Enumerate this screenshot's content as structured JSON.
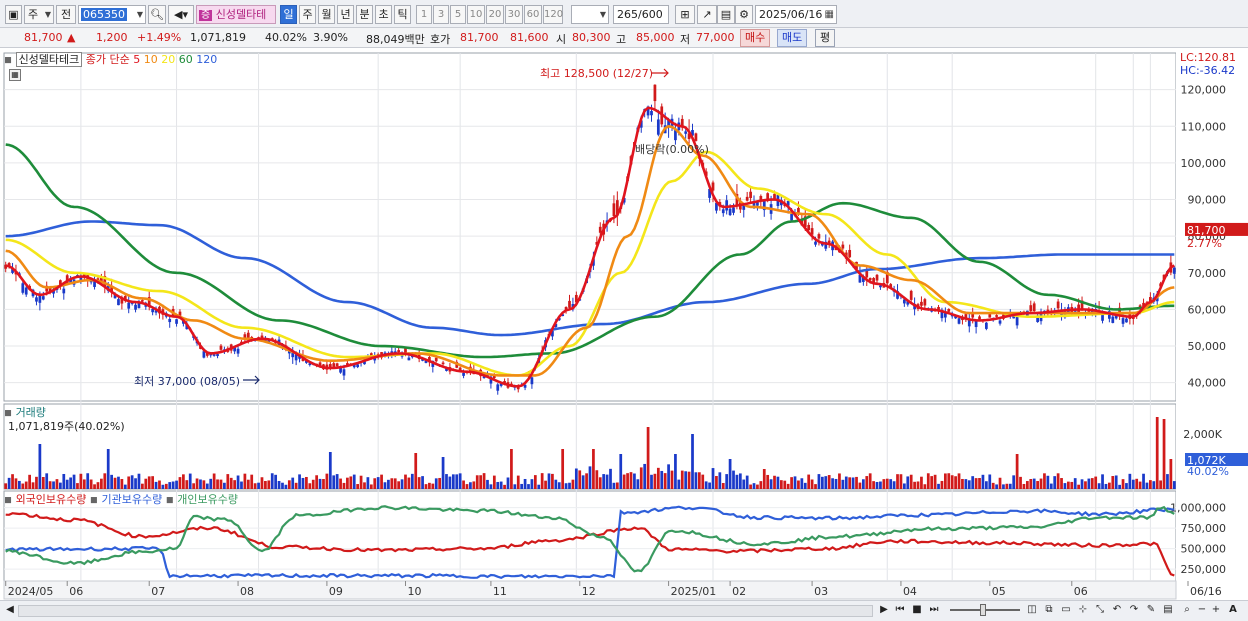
{
  "toolbar": {
    "market_label": "주",
    "prev_label": "전",
    "code": "065350",
    "stock_name": "신성델타테",
    "period_buttons": [
      "일",
      "주",
      "월",
      "년",
      "분",
      "초",
      "틱"
    ],
    "period_selected": "일",
    "num_buttons": [
      "1",
      "3",
      "5",
      "10",
      "20",
      "30",
      "60",
      "120"
    ],
    "count": "265",
    "count_total": "/600",
    "date": "2025/06/16"
  },
  "quote": {
    "price": "81,700",
    "change_arrow": "▲",
    "change": "1,200",
    "change_pct": "+1.49%",
    "volume": "1,071,819",
    "vol_ratio": "40.02%",
    "turnover": "3.90%",
    "amount": "88,049백만",
    "hoga_label": "호가",
    "ask": "81,700",
    "bid": "81,600",
    "open_label": "시",
    "open": "80,300",
    "high_label": "고",
    "high": "85,000",
    "low_label": "저",
    "low": "77,000",
    "buy_label": "매수",
    "sell_label": "매도",
    "eval_label": "평"
  },
  "price_panel": {
    "name": "신성델타테크",
    "ma_title": "종가 단순",
    "ma_periods": [
      "5",
      "10",
      "20",
      "60",
      "120"
    ],
    "lc": "LC:120.81",
    "hc": "HC:-36.42",
    "high_marker": "최고 128,500 (12/27)",
    "low_marker": "최저 37,000 (08/05)",
    "dividend_marker": "배당락(0.00%)",
    "y_ticks": [
      "120,000",
      "110,000",
      "100,000",
      "90,000",
      "80,000",
      "70,000",
      "60,000",
      "50,000",
      "40,000"
    ],
    "last_price": "81,700",
    "last_pct": "2.77%"
  },
  "volume_panel": {
    "title": "거래량",
    "value": "1,071,819주(40.02%)",
    "y_ticks": [
      "2,000K"
    ],
    "last_value": "1,072K",
    "last_pct": "40.02%"
  },
  "holdings_panel": {
    "series_labels": [
      "외국인보유수량",
      "기관보유수량",
      "개인보유수량"
    ],
    "y_ticks": [
      "1,000,000",
      "750,000",
      "500,000",
      "250,000"
    ]
  },
  "x_axis": {
    "labels": [
      "2024/05",
      "06",
      "07",
      "08",
      "09",
      "10",
      "11",
      "12",
      "2025/01",
      "02",
      "03",
      "04",
      "05",
      "06",
      "06/16"
    ]
  },
  "colors": {
    "up": "#d11a1a",
    "down": "#1a39c9",
    "ma5": "#e0141e",
    "ma10": "#f08a14",
    "ma20": "#f4e61a",
    "ma60": "#1e8c3a",
    "ma120": "#2f5fd9",
    "foreign": "#d11a1a",
    "institution": "#2f5fd9",
    "individual": "#3a9a60"
  },
  "chart_data": {
    "type": "candlestick",
    "y_range": [
      35000,
      130000
    ],
    "x_range": [
      "2024/05",
      "2025/06/16"
    ],
    "ma_anchors": {
      "ma5": [
        [
          0,
          72000
        ],
        [
          10,
          64000
        ],
        [
          22,
          69000
        ],
        [
          38,
          62000
        ],
        [
          50,
          58000
        ],
        [
          60,
          48000
        ],
        [
          75,
          52000
        ],
        [
          95,
          44000
        ],
        [
          115,
          48000
        ],
        [
          135,
          43000
        ],
        [
          150,
          39000
        ],
        [
          165,
          60000
        ],
        [
          178,
          85000
        ],
        [
          188,
          115000
        ],
        [
          198,
          110000
        ],
        [
          210,
          88000
        ],
        [
          225,
          90000
        ],
        [
          240,
          78000
        ],
        [
          255,
          67000
        ],
        [
          270,
          60000
        ],
        [
          285,
          57000
        ],
        [
          300,
          59000
        ],
        [
          315,
          60000
        ],
        [
          330,
          58000
        ],
        [
          335,
          62000
        ],
        [
          342,
          72000
        ]
      ],
      "ma10": [
        [
          0,
          76000
        ],
        [
          12,
          66000
        ],
        [
          25,
          68000
        ],
        [
          40,
          63000
        ],
        [
          55,
          57000
        ],
        [
          70,
          52000
        ],
        [
          95,
          46000
        ],
        [
          120,
          48000
        ],
        [
          145,
          42000
        ],
        [
          155,
          42000
        ],
        [
          170,
          55000
        ],
        [
          182,
          80000
        ],
        [
          194,
          110000
        ],
        [
          204,
          102000
        ],
        [
          218,
          88000
        ],
        [
          235,
          86000
        ],
        [
          250,
          72000
        ],
        [
          265,
          68000
        ],
        [
          282,
          59000
        ],
        [
          300,
          59000
        ],
        [
          330,
          59000
        ],
        [
          342,
          66000
        ]
      ],
      "ma20": [
        [
          0,
          79000
        ],
        [
          20,
          70000
        ],
        [
          45,
          65000
        ],
        [
          70,
          55000
        ],
        [
          100,
          47000
        ],
        [
          125,
          48000
        ],
        [
          150,
          42000
        ],
        [
          165,
          50000
        ],
        [
          180,
          70000
        ],
        [
          195,
          95000
        ],
        [
          205,
          103000
        ],
        [
          220,
          93000
        ],
        [
          240,
          86000
        ],
        [
          258,
          75000
        ],
        [
          275,
          62000
        ],
        [
          300,
          58000
        ],
        [
          330,
          59000
        ],
        [
          342,
          62000
        ]
      ],
      "ma60": [
        [
          0,
          105000
        ],
        [
          20,
          88000
        ],
        [
          50,
          70000
        ],
        [
          80,
          57000
        ],
        [
          110,
          50000
        ],
        [
          140,
          47000
        ],
        [
          160,
          48000
        ],
        [
          190,
          58000
        ],
        [
          215,
          75000
        ],
        [
          230,
          84000
        ],
        [
          245,
          89000
        ],
        [
          265,
          85000
        ],
        [
          285,
          73000
        ],
        [
          305,
          64000
        ],
        [
          325,
          60000
        ],
        [
          342,
          61000
        ]
      ],
      "ma120": [
        [
          0,
          80000
        ],
        [
          25,
          84000
        ],
        [
          45,
          83000
        ],
        [
          70,
          74000
        ],
        [
          100,
          62000
        ],
        [
          125,
          55000
        ],
        [
          145,
          53000
        ],
        [
          175,
          56000
        ],
        [
          205,
          62000
        ],
        [
          235,
          67000
        ],
        [
          255,
          71000
        ],
        [
          285,
          74000
        ],
        [
          310,
          75000
        ],
        [
          330,
          75000
        ],
        [
          342,
          75000
        ]
      ]
    },
    "holdings_anchors": {
      "foreign": [
        [
          0,
          930000
        ],
        [
          20,
          850000
        ],
        [
          40,
          650000
        ],
        [
          60,
          750000
        ],
        [
          80,
          520000
        ],
        [
          110,
          480000
        ],
        [
          140,
          500000
        ],
        [
          160,
          600000
        ],
        [
          185,
          750000
        ],
        [
          195,
          490000
        ],
        [
          215,
          470000
        ],
        [
          240,
          500000
        ],
        [
          260,
          590000
        ],
        [
          290,
          570000
        ],
        [
          320,
          540000
        ],
        [
          336,
          560000
        ],
        [
          342,
          160000
        ]
      ],
      "institution": [
        [
          0,
          490000
        ],
        [
          45,
          500000
        ],
        [
          48,
          170000
        ],
        [
          120,
          170000
        ],
        [
          150,
          160000
        ],
        [
          178,
          170000
        ],
        [
          180,
          940000
        ],
        [
          200,
          1000000
        ],
        [
          220,
          880000
        ],
        [
          240,
          870000
        ],
        [
          270,
          910000
        ],
        [
          300,
          960000
        ],
        [
          320,
          920000
        ],
        [
          342,
          980000
        ]
      ],
      "individual": [
        [
          0,
          470000
        ],
        [
          20,
          320000
        ],
        [
          40,
          460000
        ],
        [
          50,
          500000
        ],
        [
          55,
          880000
        ],
        [
          65,
          850000
        ],
        [
          75,
          470000
        ],
        [
          85,
          900000
        ],
        [
          110,
          1000000
        ],
        [
          140,
          960000
        ],
        [
          160,
          880000
        ],
        [
          175,
          640000
        ],
        [
          185,
          220000
        ],
        [
          195,
          720000
        ],
        [
          220,
          560000
        ],
        [
          245,
          650000
        ],
        [
          270,
          740000
        ],
        [
          300,
          760000
        ],
        [
          320,
          880000
        ],
        [
          335,
          880000
        ],
        [
          338,
          1000000
        ],
        [
          342,
          940000
        ]
      ]
    }
  }
}
